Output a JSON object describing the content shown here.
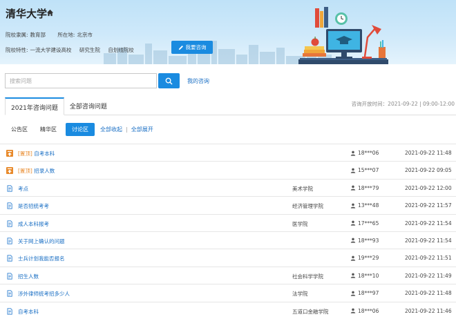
{
  "header": {
    "school_name": "清华大学",
    "affiliation_label": "院校隶属:",
    "affiliation_value": "教育部",
    "location_label": "所在地:",
    "location_value": "北京市",
    "features_label": "院校特性:",
    "features": [
      "一流大学建设高校",
      "研究生院",
      "自划线院校"
    ],
    "ask_button": "我要咨询"
  },
  "search": {
    "placeholder": "搜索问题",
    "my_consult": "我的咨询"
  },
  "tabs": [
    "2021年咨询问题",
    "全部咨询问题"
  ],
  "consult_time": "咨询开放时间：2021-09-22 | 09:00-12:00",
  "filters": {
    "items": [
      "公告区",
      "精华区",
      "讨论区"
    ],
    "active": "讨论区",
    "collapse_all": "全部收起",
    "separator": "|",
    "expand_all": "全部展开"
  },
  "rows": [
    {
      "pinned": true,
      "tag": "[置顶]",
      "title": "自考本科",
      "college": "",
      "user": "18***06",
      "time": "2021-09-22 11:48"
    },
    {
      "pinned": true,
      "tag": "[置顶]",
      "title": "招录人数",
      "college": "",
      "user": "15***07",
      "time": "2021-09-22 09:05"
    },
    {
      "pinned": false,
      "tag": "",
      "title": "考点",
      "college": "美术学院",
      "user": "18***79",
      "time": "2021-09-22 12:00"
    },
    {
      "pinned": false,
      "tag": "",
      "title": "是否招统考考",
      "college": "经济管理学院",
      "user": "13***48",
      "time": "2021-09-22 11:57"
    },
    {
      "pinned": false,
      "tag": "",
      "title": "成人本科报考",
      "college": "医学院",
      "user": "17***65",
      "time": "2021-09-22 11:54"
    },
    {
      "pinned": false,
      "tag": "",
      "title": "关于网上确认的问题",
      "college": "",
      "user": "18***93",
      "time": "2021-09-22 11:54"
    },
    {
      "pinned": false,
      "tag": "",
      "title": "士兵计划我能否报名",
      "college": "",
      "user": "19***29",
      "time": "2021-09-22 11:51"
    },
    {
      "pinned": false,
      "tag": "",
      "title": "招生人数",
      "college": "社会科学学院",
      "user": "18***10",
      "time": "2021-09-22 11:49"
    },
    {
      "pinned": false,
      "tag": "",
      "title": "涉外律师统考招多少人",
      "college": "法学院",
      "user": "18***97",
      "time": "2021-09-22 11:48"
    },
    {
      "pinned": false,
      "tag": "",
      "title": "自考本科",
      "college": "五道口金融学院",
      "user": "18***06",
      "time": "2021-09-22 11:46"
    }
  ],
  "colors": {
    "accent": "#1a8be0",
    "link": "#1a6fc4",
    "pinned": "#e8892a"
  }
}
